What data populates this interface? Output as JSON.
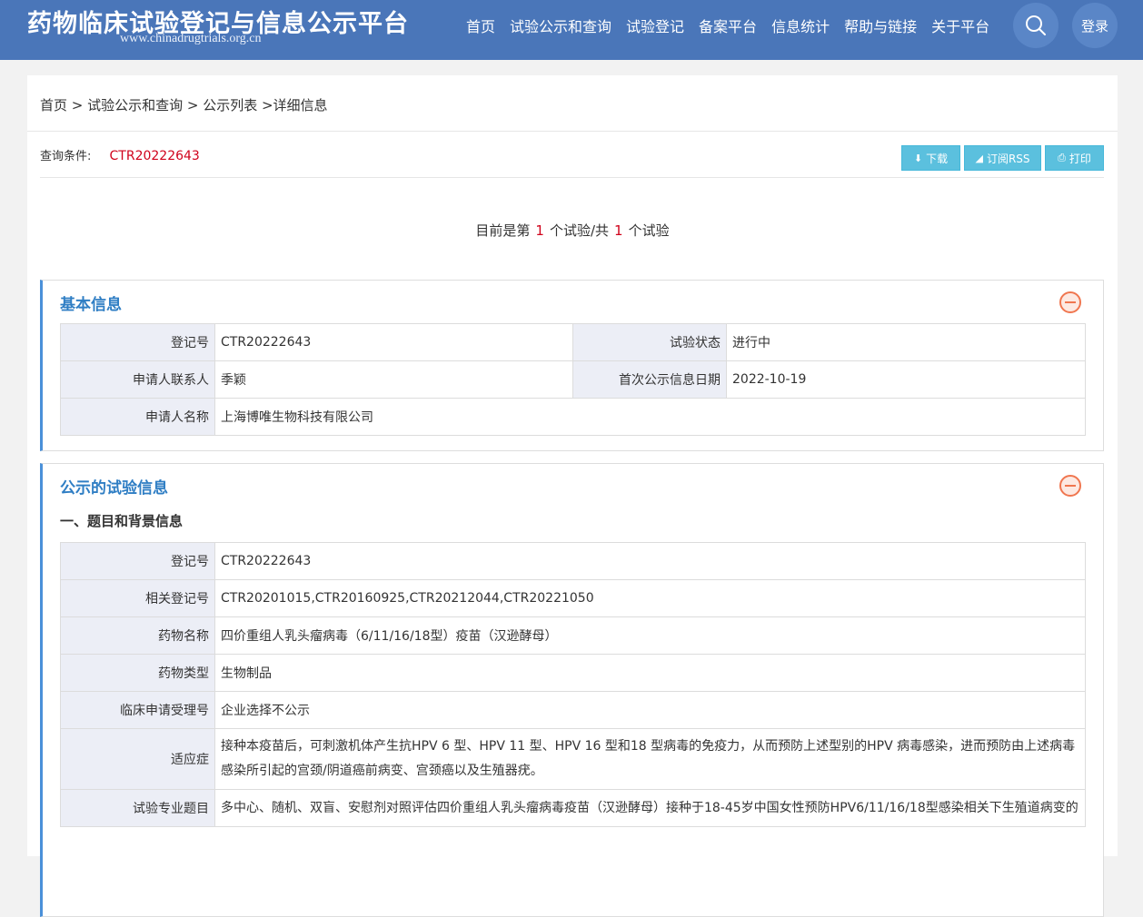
{
  "header": {
    "site_title": "药物临床试验登记与信息公示平台",
    "site_url": "www.chinadrugtrials.org.cn",
    "nav": [
      "首页",
      "试验公示和查询",
      "试验登记",
      "备案平台",
      "信息统计",
      "帮助与链接",
      "关于平台"
    ],
    "search_icon": "search-icon",
    "login_label": "登录"
  },
  "breadcrumb": "首页 > 试验公示和查询 > 公示列表 >详细信息",
  "query": {
    "label": "查询条件:",
    "value": "CTR20222643"
  },
  "toolbar": {
    "download": "下载",
    "rss": "订阅RSS",
    "print": "打印"
  },
  "count": {
    "prefix": "目前是第",
    "current": "1",
    "middle": "个试验/共",
    "total": "1",
    "suffix": "个试验"
  },
  "basic_info": {
    "title": "基本信息",
    "rows": [
      {
        "l1": "登记号",
        "v1": "CTR20222643",
        "l2": "试验状态",
        "v2": "进行中"
      },
      {
        "l1": "申请人联系人",
        "v1": "季颖",
        "l2": "首次公示信息日期",
        "v2": "2022-10-19"
      },
      {
        "l1": "申请人名称",
        "v1": "上海博唯生物科技有限公司"
      }
    ]
  },
  "trial_info": {
    "title": "公示的试验信息",
    "subtitle": "一、题目和背景信息",
    "rows": [
      {
        "label": "登记号",
        "value": "CTR20222643"
      },
      {
        "label": "相关登记号",
        "value": "CTR20201015,CTR20160925,CTR20212044,CTR20221050"
      },
      {
        "label": "药物名称",
        "value": "四价重组人乳头瘤病毒（6/11/16/18型）疫苗（汉逊酵母）"
      },
      {
        "label": "药物类型",
        "value": "生物制品"
      },
      {
        "label": "临床申请受理号",
        "value": "企业选择不公示"
      },
      {
        "label": "适应症",
        "value": "接种本疫苗后，可刺激机体产生抗HPV 6 型、HPV 11 型、HPV 16 型和18 型病毒的免疫力，从而预防上述型别的HPV 病毒感染，进而预防由上述病毒感染所引起的宫颈/阴道癌前病变、宫颈癌以及生殖器疣。"
      },
      {
        "label": "试验专业题目",
        "value": "多中心、随机、双盲、安慰剂对照评估四价重组人乳头瘤病毒疫苗（汉逊酵母）接种于18-45岁中国女性预防HPV6/11/16/18型感染相关下生殖道病变的"
      }
    ]
  },
  "colors": {
    "header_bg": "#4a76b9",
    "accent_blue": "#2f7ec4",
    "highlight_red": "#d0021b",
    "button_bg": "#5bc0de",
    "collapse_orange": "#f0764f"
  }
}
